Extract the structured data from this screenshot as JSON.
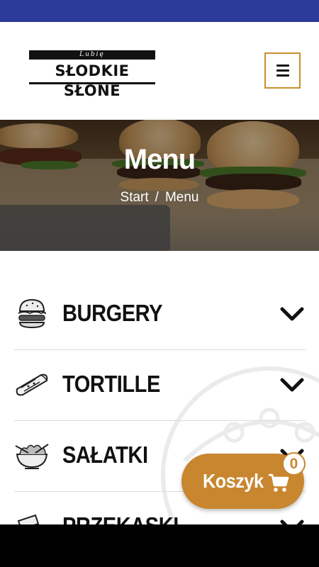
{
  "brand": {
    "top_text": "Lubię",
    "name": "SŁODKIE SŁONE"
  },
  "header": {
    "menu_button": "menu"
  },
  "hero": {
    "title": "Menu",
    "breadcrumb": [
      "Start",
      "/",
      "Menu"
    ]
  },
  "menu": {
    "items": [
      {
        "label": "BURGERY",
        "icon": "burger-icon"
      },
      {
        "label": "TORTILLE",
        "icon": "tortilla-icon"
      },
      {
        "label": "SAŁATKI",
        "icon": "salad-icon"
      },
      {
        "label": "PRZEKĄSKI",
        "icon": "snack-icon"
      }
    ]
  },
  "cart": {
    "label": "Koszyk",
    "count": "0"
  },
  "colors": {
    "status_bar": "#2c3b9a",
    "accent": "#c8862f",
    "text": "#111111"
  }
}
